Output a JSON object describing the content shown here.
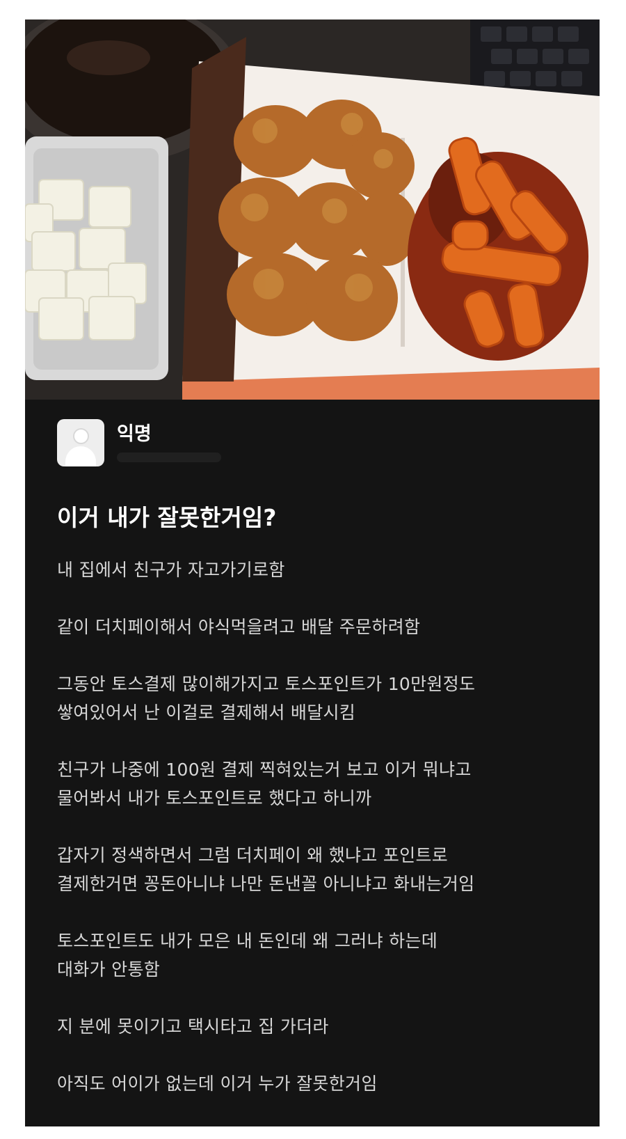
{
  "post": {
    "author": "익명",
    "title": "이거 내가 잘못한거임?",
    "paragraphs": [
      [
        "내 집에서 친구가 자고가기로함"
      ],
      [
        "같이 더치페이해서 야식먹을려고 배달 주문하려함"
      ],
      [
        "그동안 토스결제 많이해가지고 토스포인트가 10만원정도",
        "쌓여있어서 난 이걸로 결제해서 배달시킴"
      ],
      [
        "친구가 나중에 100원 결제 찍혀있는거 보고 이거 뭐냐고",
        "물어봐서 내가 토스포인트로 했다고 하니까"
      ],
      [
        "갑자기 정색하면서 그럼 더치페이 왜 했냐고 포인트로",
        "결제한거면 꽁돈아니냐 나만 돈낸꼴 아니냐고 화내는거임"
      ],
      [
        "토스포인트도 내가 모은 내 돈인데 왜 그러냐 하는데",
        "대화가 안통함"
      ],
      [
        "지 분에 못이기고 택시타고 집 가더라"
      ],
      [
        "아직도 어이가 없는데 이거 누가 잘못한거임"
      ]
    ]
  },
  "photo": {
    "icon": "food-photo",
    "colors": {
      "drink": "#1c130e",
      "container": "#d9d9d9",
      "radish": "#f3f1e4",
      "box": "#f4efea",
      "box_edge": "#e47d52",
      "fried_chicken": "#b56a2a",
      "tteokbokki": "#e26b1e",
      "sauce": "#8a2a12",
      "keyboard": "#1a1a1e"
    }
  },
  "theme": {
    "background": "#141414",
    "title_color": "#ffffff",
    "text_color": "#d7d7d7"
  }
}
